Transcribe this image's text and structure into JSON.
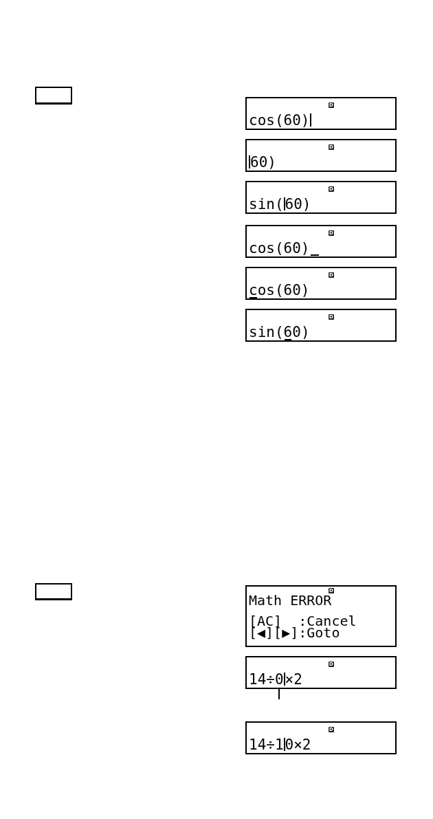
{
  "sections": [
    {
      "groups": [
        {
          "displays": [
            {
              "kind": "input",
              "indicator": "D",
              "segments": [
                {
                  "kind": "text",
                  "text": "cos(60)"
                },
                {
                  "kind": "bar"
                }
              ]
            },
            {
              "kind": "input",
              "indicator": "D",
              "segments": [
                {
                  "kind": "bar"
                },
                {
                  "kind": "text",
                  "text": "60)"
                }
              ]
            },
            {
              "kind": "input",
              "indicator": "D",
              "segments": [
                {
                  "kind": "text",
                  "text": "sin("
                },
                {
                  "kind": "bar"
                },
                {
                  "kind": "text",
                  "text": "60)"
                }
              ]
            }
          ]
        },
        {
          "displays": [
            {
              "kind": "input",
              "indicator": "D",
              "segments": [
                {
                  "kind": "text",
                  "text": "cos(60)"
                },
                {
                  "kind": "underline"
                }
              ]
            },
            {
              "kind": "input",
              "indicator": "D",
              "segments": [
                {
                  "kind": "underlined",
                  "text": "c"
                },
                {
                  "kind": "text",
                  "text": "os(60)"
                }
              ]
            },
            {
              "kind": "input",
              "indicator": "D",
              "segments": [
                {
                  "kind": "text",
                  "text": "sin("
                },
                {
                  "kind": "underlined",
                  "text": "6"
                },
                {
                  "kind": "text",
                  "text": "0)"
                }
              ]
            }
          ]
        }
      ]
    },
    {
      "groups": [
        {
          "displays": [
            {
              "kind": "error",
              "indicator": "D",
              "message": "Math ERROR",
              "options": [
                "[AC]  :Cancel",
                "[◀][▶]:Goto"
              ]
            },
            {
              "kind": "input",
              "indicator": "D",
              "segments": [
                {
                  "kind": "text",
                  "text": "14÷"
                },
                {
                  "kind": "pointed",
                  "text": "0"
                },
                {
                  "kind": "bar"
                },
                {
                  "kind": "text",
                  "text": "×2"
                }
              ]
            }
          ]
        },
        {
          "displays": [
            {
              "kind": "input",
              "indicator": "D",
              "segments": [
                {
                  "kind": "text",
                  "text": "14÷1"
                },
                {
                  "kind": "bar"
                },
                {
                  "kind": "text",
                  "text": "0×2"
                }
              ]
            }
          ]
        }
      ]
    }
  ]
}
